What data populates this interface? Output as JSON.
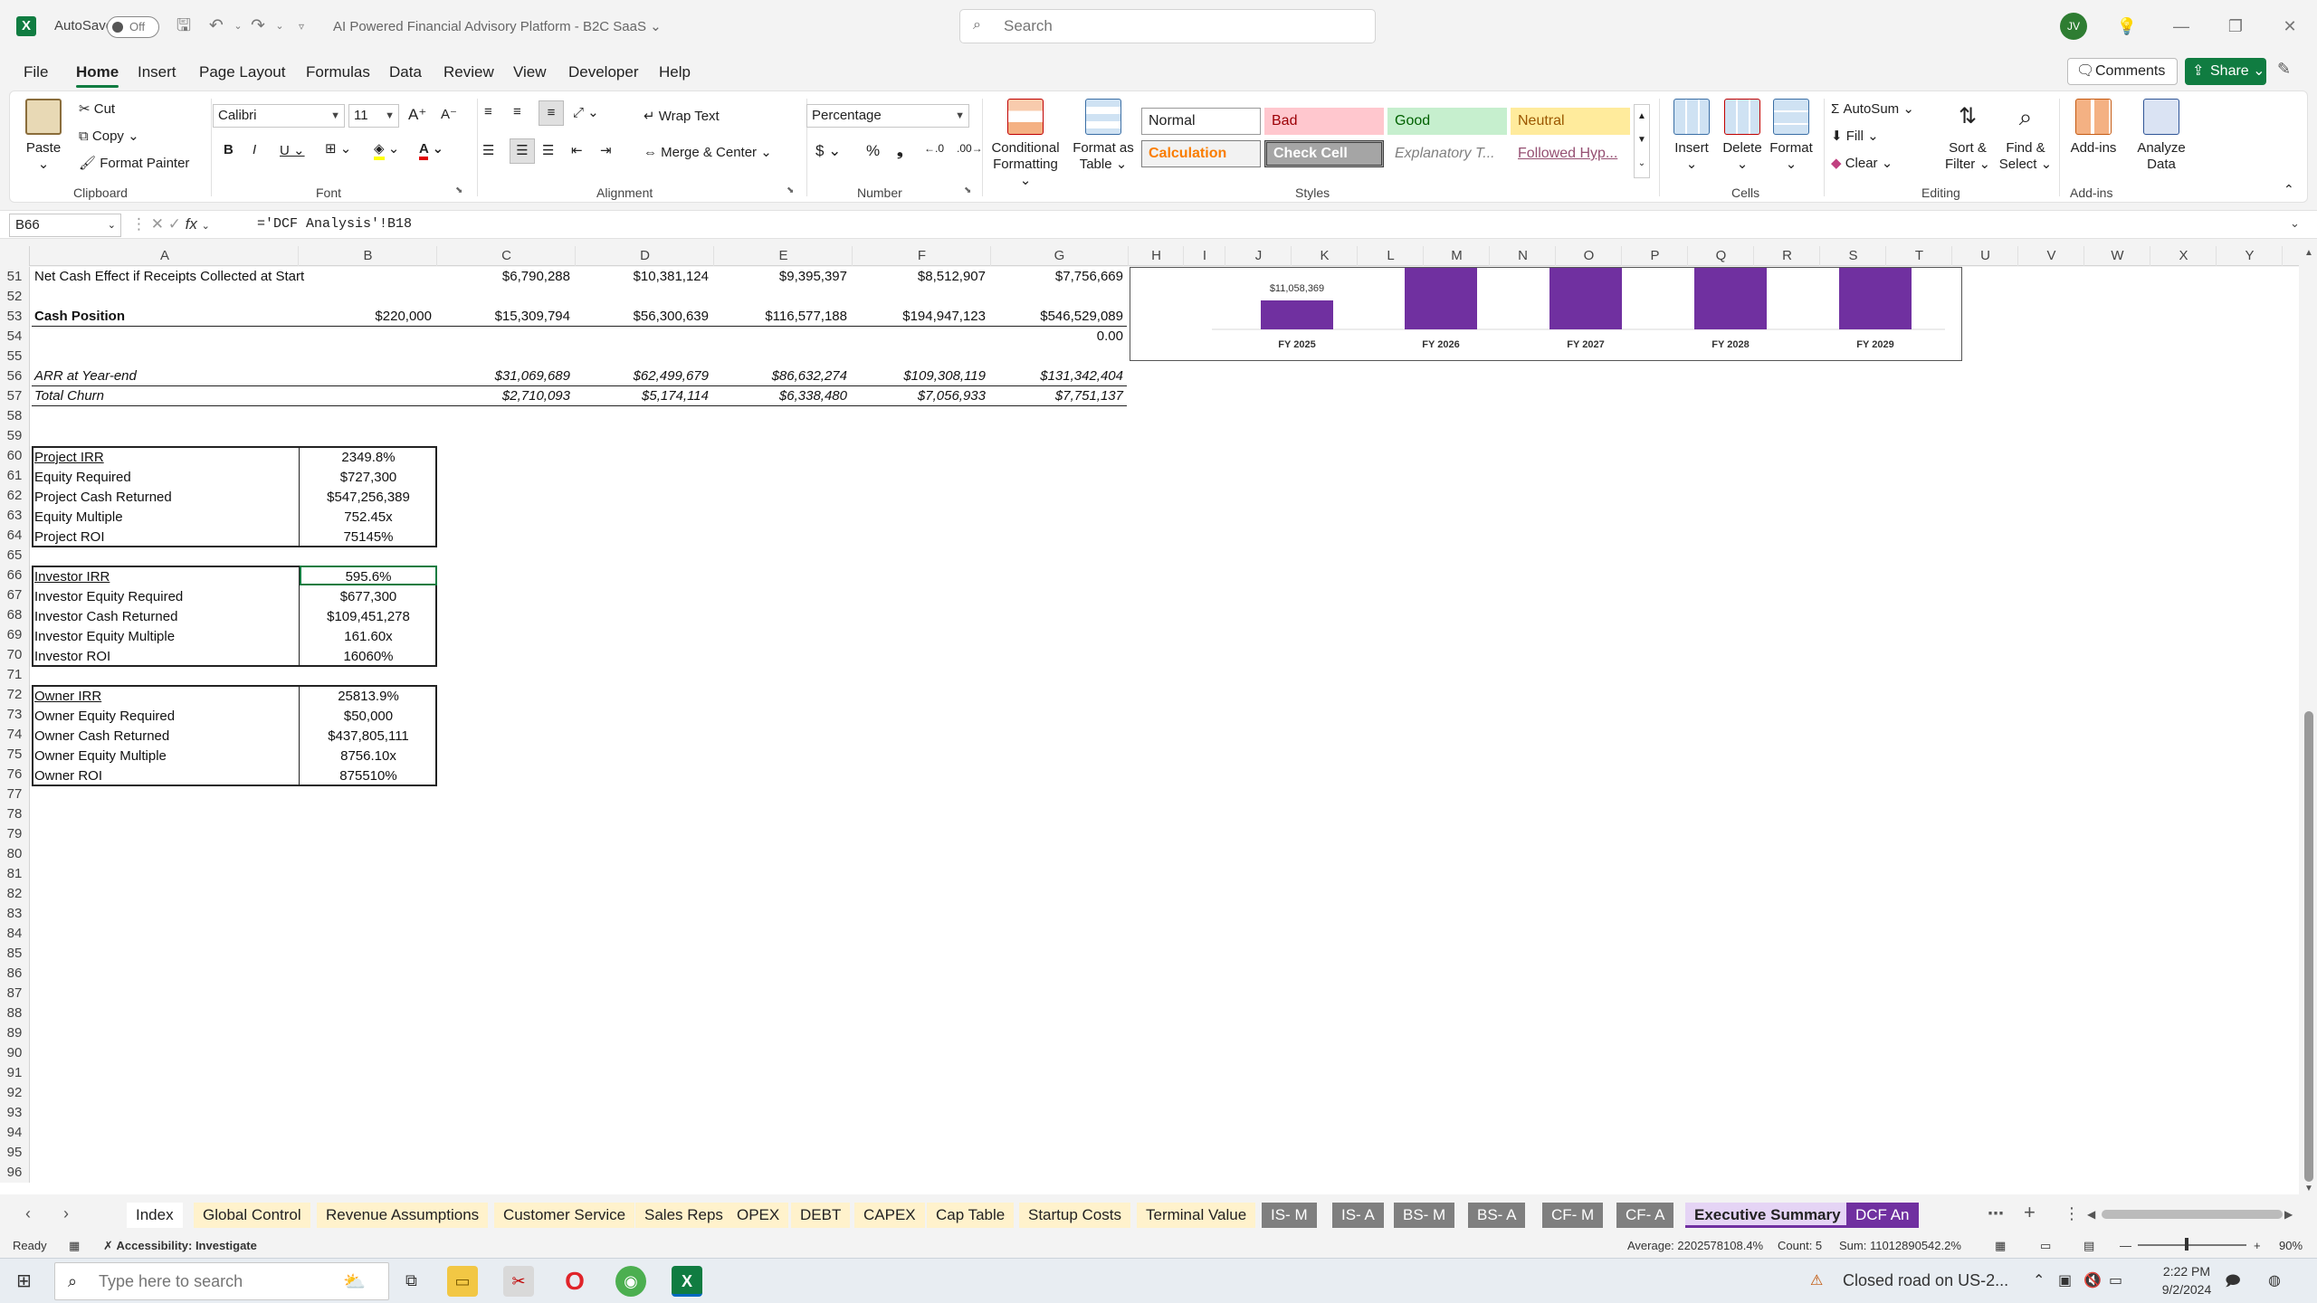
{
  "titlebar": {
    "autosave_label": "AutoSave",
    "autosave_state": "Off",
    "doc_title": "AI Powered Financial Advisory Platform - B2C SaaS",
    "search_placeholder": "Search",
    "avatar_initials": "JV"
  },
  "menu": {
    "tabs": [
      "File",
      "Home",
      "Insert",
      "Page Layout",
      "Formulas",
      "Data",
      "Review",
      "View",
      "Developer",
      "Help"
    ],
    "active": "Home",
    "comments": "Comments",
    "share": "Share"
  },
  "ribbon": {
    "clipboard": {
      "paste": "Paste",
      "cut": "Cut",
      "copy": "Copy",
      "format_painter": "Format Painter",
      "label": "Clipboard"
    },
    "font": {
      "name": "Calibri",
      "size": "11",
      "label": "Font"
    },
    "alignment": {
      "wrap_text": "Wrap Text",
      "merge_center": "Merge & Center",
      "label": "Alignment"
    },
    "number": {
      "format": "Percentage",
      "label": "Number"
    },
    "styles": {
      "conditional_formatting": "Conditional Formatting",
      "format_as_table": "Format as Table",
      "cells": [
        "Normal",
        "Bad",
        "Good",
        "Neutral",
        "Calculation",
        "Check Cell",
        "Explanatory T...",
        "Followed Hyp..."
      ],
      "label": "Styles"
    },
    "cells": {
      "insert": "Insert",
      "delete": "Delete",
      "format": "Format",
      "label": "Cells"
    },
    "editing": {
      "autosum": "AutoSum",
      "fill": "Fill",
      "clear": "Clear",
      "sort_filter": "Sort & Filter",
      "find_select": "Find & Select",
      "label": "Editing"
    },
    "addins": {
      "addins": "Add-ins",
      "analyze": "Analyze Data",
      "label": "Add-ins"
    }
  },
  "formula_bar": {
    "name_box": "B66",
    "formula": "='DCF Analysis'!B18"
  },
  "columns": [
    "A",
    "B",
    "C",
    "D",
    "E",
    "F",
    "G",
    "H",
    "I",
    "J",
    "K",
    "L",
    "M",
    "N",
    "O",
    "P",
    "Q",
    "R",
    "S",
    "T",
    "U",
    "V",
    "W",
    "X",
    "Y"
  ],
  "rows": {
    "numbers": [
      "51",
      "52",
      "53",
      "54",
      "55",
      "56",
      "57",
      "58",
      "59",
      "60",
      "61",
      "62",
      "63",
      "64",
      "65",
      "66",
      "67",
      "68",
      "69",
      "70",
      "71",
      "72",
      "73",
      "74",
      "75",
      "76",
      "77",
      "78",
      "79",
      "80",
      "81",
      "82",
      "83",
      "84",
      "85",
      "86",
      "87",
      "88",
      "89",
      "90",
      "91",
      "92",
      "93",
      "94",
      "95",
      "96"
    ],
    "net_cash": {
      "label": "Net Cash Effect if Receipts Collected at Start",
      "values": [
        "$6,790,288",
        "$10,381,124",
        "$9,395,397",
        "$8,512,907",
        "$7,756,669"
      ]
    },
    "cash_position": {
      "label": "Cash Position",
      "b": "$220,000",
      "values": [
        "$15,309,794",
        "$56,300,639",
        "$116,577,188",
        "$194,947,123",
        "$546,529,089"
      ]
    },
    "row54_g": "0.00",
    "arr": {
      "label": "ARR at Year-end",
      "values": [
        "$31,069,689",
        "$62,499,679",
        "$86,632,274",
        "$109,308,119",
        "$131,342,404"
      ]
    },
    "churn": {
      "label": "Total Churn",
      "values": [
        "$2,710,093",
        "$5,174,114",
        "$6,338,480",
        "$7,056,933",
        "$7,751,137"
      ]
    }
  },
  "metrics": {
    "project": [
      [
        "Project IRR",
        "2349.8%"
      ],
      [
        "Equity Required",
        "$727,300"
      ],
      [
        "Project Cash Returned",
        "$547,256,389"
      ],
      [
        "Equity Multiple",
        "752.45x"
      ],
      [
        "Project ROI",
        "75145%"
      ]
    ],
    "investor": [
      [
        "Investor IRR",
        "595.6%"
      ],
      [
        "Investor Equity Required",
        "$677,300"
      ],
      [
        "Investor Cash Returned",
        "$109,451,278"
      ],
      [
        "Investor Equity Multiple",
        "161.60x"
      ],
      [
        "Investor ROI",
        "16060%"
      ]
    ],
    "owner": [
      [
        "Owner IRR",
        "25813.9%"
      ],
      [
        "Owner Equity Required",
        "$50,000"
      ],
      [
        "Owner Cash Returned",
        "$437,805,111"
      ],
      [
        "Owner Equity Multiple",
        "8756.10x"
      ],
      [
        "Owner ROI",
        "875510%"
      ]
    ]
  },
  "chart_data": {
    "type": "bar",
    "categories": [
      "FY 2025",
      "FY 2026",
      "FY 2027",
      "FY 2028",
      "FY 2029"
    ],
    "values": [
      11058369
    ],
    "data_labels": [
      "$11,058,369"
    ],
    "bar_color": "#7030a0"
  },
  "sheet_tabs": [
    {
      "label": "Index",
      "bg": "#ffffff",
      "fg": "#222222"
    },
    {
      "label": "Global Control",
      "bg": "#fff2cc",
      "fg": "#222222"
    },
    {
      "label": "Revenue Assumptions",
      "bg": "#fff2cc",
      "fg": "#222222"
    },
    {
      "label": "Customer Service",
      "bg": "#fff2cc",
      "fg": "#222222"
    },
    {
      "label": "Sales Reps",
      "bg": "#fff2cc",
      "fg": "#222222"
    },
    {
      "label": "OPEX",
      "bg": "#fff2cc",
      "fg": "#222222"
    },
    {
      "label": "DEBT",
      "bg": "#fff2cc",
      "fg": "#222222"
    },
    {
      "label": "CAPEX",
      "bg": "#fff2cc",
      "fg": "#222222"
    },
    {
      "label": "Cap Table",
      "bg": "#fff2cc",
      "fg": "#222222"
    },
    {
      "label": "Startup Costs",
      "bg": "#fff2cc",
      "fg": "#222222"
    },
    {
      "label": "Terminal Value",
      "bg": "#fff2cc",
      "fg": "#222222"
    },
    {
      "label": "IS- M",
      "bg": "#7f7f7f",
      "fg": "#ffffff"
    },
    {
      "label": "IS- A",
      "bg": "#7f7f7f",
      "fg": "#ffffff"
    },
    {
      "label": "BS- M",
      "bg": "#7f7f7f",
      "fg": "#ffffff"
    },
    {
      "label": "BS- A",
      "bg": "#7f7f7f",
      "fg": "#ffffff"
    },
    {
      "label": "CF- M",
      "bg": "#7f7f7f",
      "fg": "#ffffff"
    },
    {
      "label": "CF- A",
      "bg": "#7f7f7f",
      "fg": "#ffffff"
    },
    {
      "label": "Executive Summary",
      "bg": "#e5d4f5",
      "fg": "#222222"
    },
    {
      "label": "DCF An",
      "bg": "#7030a0",
      "fg": "#ffffff"
    }
  ],
  "status": {
    "ready": "Ready",
    "accessibility": "Accessibility: Investigate",
    "average": "Average: 2202578108.4%",
    "count": "Count: 5",
    "sum": "Sum: 11012890542.2%",
    "zoom": "90%"
  },
  "taskbar": {
    "search_placeholder": "Type here to search",
    "weather": "Closed road on US-2...",
    "time": "2:22 PM",
    "date": "9/2/2024"
  }
}
